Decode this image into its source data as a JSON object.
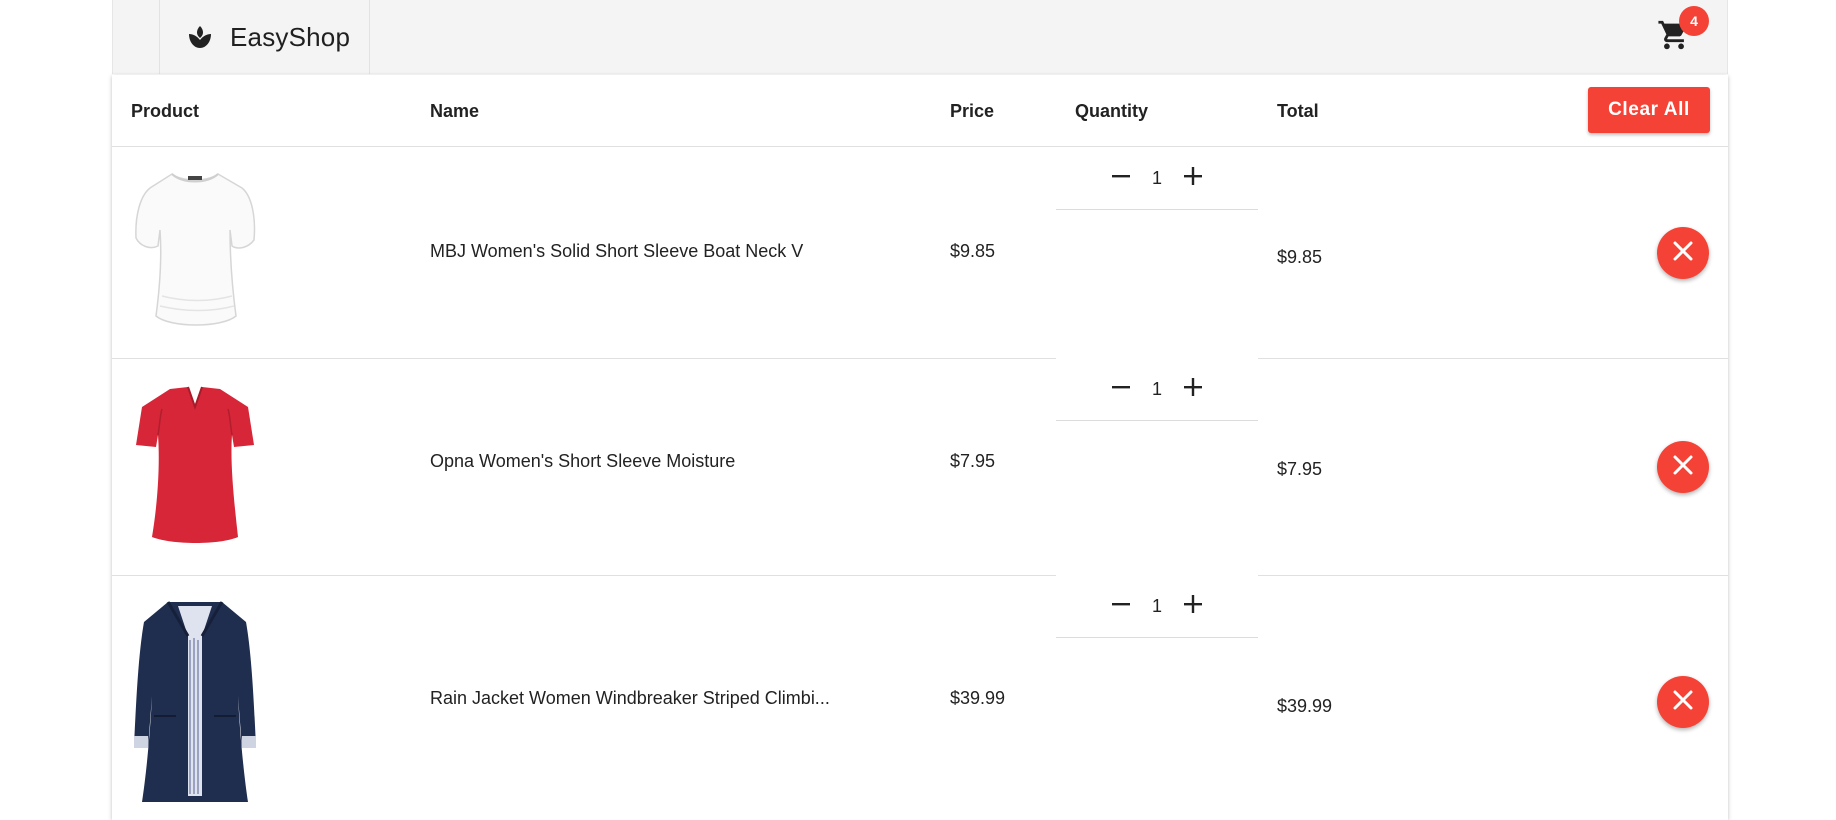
{
  "app": {
    "brand": "EasyShop",
    "cart_count": "4"
  },
  "table": {
    "headers": {
      "product": "Product",
      "name": "Name",
      "price": "Price",
      "quantity": "Quantity",
      "total": "Total"
    },
    "clear_label": "Clear All",
    "rows": [
      {
        "name": "MBJ Women's Solid Short Sleeve Boat Neck V",
        "price": "$9.85",
        "quantity": "1",
        "total": "$9.85",
        "image": "white-tshirt"
      },
      {
        "name": "Opna Women's Short Sleeve Moisture",
        "price": "$7.95",
        "quantity": "1",
        "total": "$7.95",
        "image": "red-tshirt"
      },
      {
        "name": "Rain Jacket Women Windbreaker Striped Climbi...",
        "price": "$39.99",
        "quantity": "1",
        "total": "$39.99",
        "image": "navy-jacket"
      }
    ]
  },
  "colors": {
    "accent": "#f44336",
    "topbar": "#f4f4f4"
  },
  "icons": {
    "logo": "leaf-logo-icon",
    "cart": "cart-icon",
    "minus": "minus-icon",
    "plus": "plus-icon",
    "remove": "close-icon"
  }
}
